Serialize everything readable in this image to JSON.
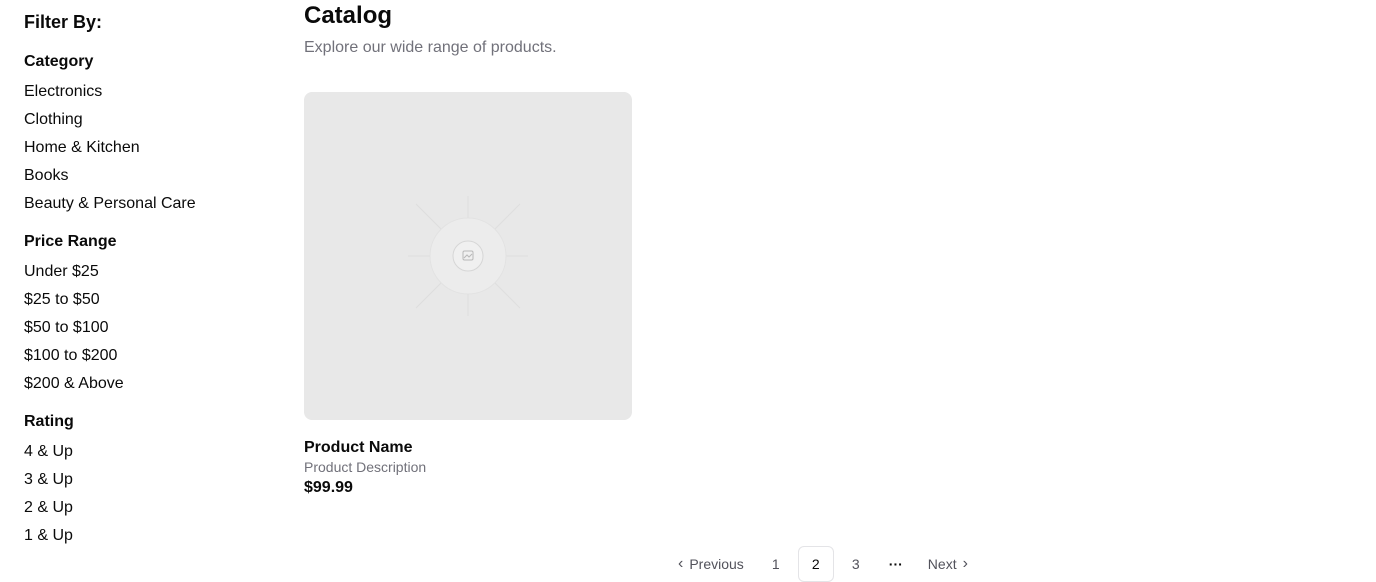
{
  "sidebar": {
    "title": "Filter By:",
    "sections": [
      {
        "title": "Category",
        "items": [
          "Electronics",
          "Clothing",
          "Home & Kitchen",
          "Books",
          "Beauty & Personal Care"
        ]
      },
      {
        "title": "Price Range",
        "items": [
          "Under $25",
          "$25 to $50",
          "$50 to $100",
          "$100 to $200",
          "$200 & Above"
        ]
      },
      {
        "title": "Rating",
        "items": [
          "4 & Up",
          "3 & Up",
          "2 & Up",
          "1 & Up"
        ]
      }
    ]
  },
  "main": {
    "title": "Catalog",
    "subtitle": "Explore our wide range of products."
  },
  "product": {
    "name": "Product Name",
    "description": "Product Description",
    "price": "$99.99",
    "image_icon": "image-placeholder-icon"
  },
  "pagination": {
    "previous_label": "Previous",
    "next_label": "Next",
    "pages": [
      "1",
      "2",
      "3"
    ],
    "current_page": "2",
    "ellipsis": "···"
  },
  "colors": {
    "text": "#0a0a0a",
    "muted": "#71717a",
    "image_bg": "#e8e8e8",
    "border": "#e4e4e7"
  }
}
